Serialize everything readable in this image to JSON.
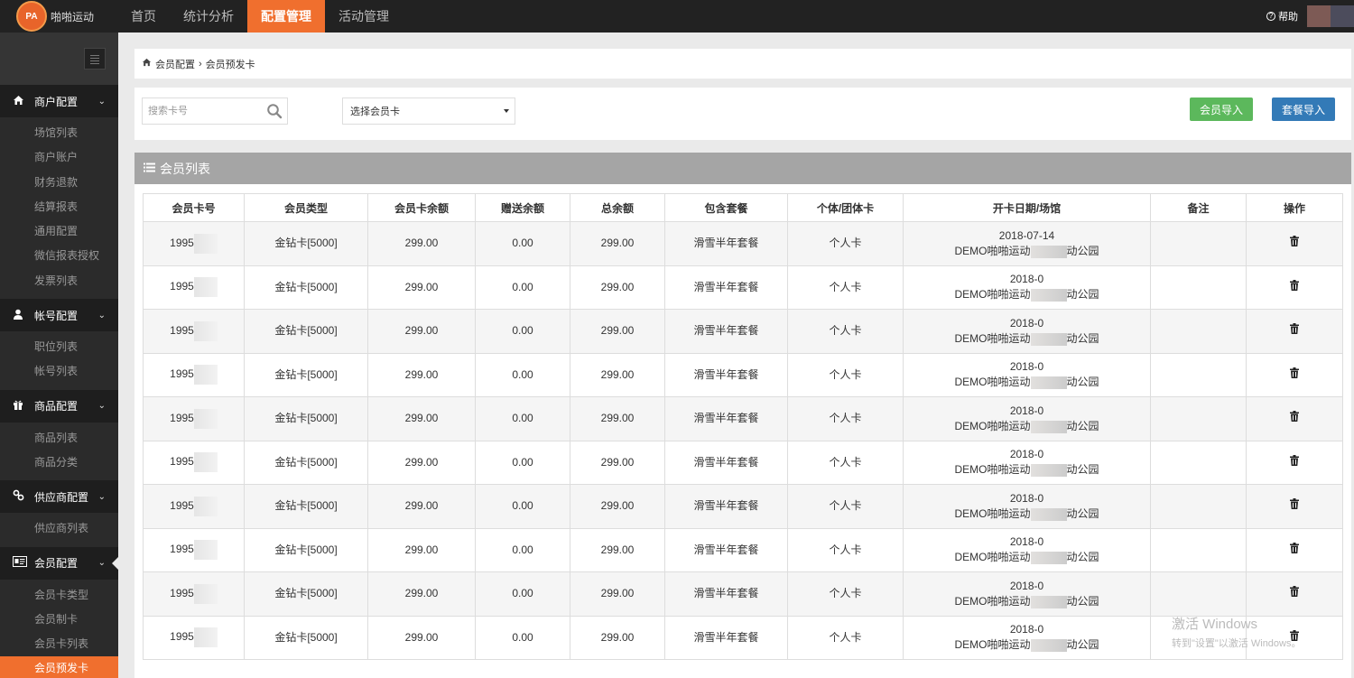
{
  "app": {
    "name": "啪啪运动",
    "logo_icon": "logo-badge",
    "accent_color": "#f06f2e"
  },
  "topnav": {
    "items": [
      {
        "label": "首页"
      },
      {
        "label": "统计分析"
      },
      {
        "label": "配置管理",
        "active": true
      },
      {
        "label": "活动管理"
      }
    ],
    "help_label": "帮助"
  },
  "sidebar": {
    "groups": [
      {
        "label": "商户配置",
        "icon": "home-icon",
        "items": [
          "场馆列表",
          "商户账户",
          "财务退款",
          "结算报表",
          "通用配置",
          "微信报表授权",
          "发票列表"
        ]
      },
      {
        "label": "帐号配置",
        "icon": "user-icon",
        "items": [
          "职位列表",
          "帐号列表"
        ]
      },
      {
        "label": "商品配置",
        "icon": "gift-icon",
        "items": [
          "商品列表",
          "商品分类"
        ]
      },
      {
        "label": "供应商配置",
        "icon": "link-icon",
        "items": [
          "供应商列表"
        ]
      },
      {
        "label": "会员配置",
        "icon": "id-card-icon",
        "items": [
          "会员卡类型",
          "会员制卡",
          "会员卡列表",
          "会员预发卡"
        ]
      }
    ],
    "active_item": "会员预发卡"
  },
  "breadcrumb": {
    "parent": "会员配置",
    "current": "会员预发卡"
  },
  "filter": {
    "search_placeholder": "搜索卡号",
    "select_value": "选择会员卡",
    "import_button": "会员导入",
    "package_button": "套餐导入"
  },
  "panel": {
    "title": "会员列表"
  },
  "table": {
    "headers": [
      "会员卡号",
      "会员类型",
      "会员卡余额",
      "赠送余额",
      "总余额",
      "包含套餐",
      "个体/团体卡",
      "开卡日期/场馆",
      "备注",
      "操作"
    ],
    "rows": [
      {
        "card": "1995",
        "type": "金钻卡[5000]",
        "balance": "299.00",
        "gift": "0.00",
        "total": "299.00",
        "package": "滑雪半年套餐",
        "kind": "个人卡",
        "date": "2018-07-14",
        "venue_a": "DEMO啪啪运动",
        "venue_b": "动公园",
        "note": ""
      },
      {
        "card": "1995",
        "type": "金钻卡[5000]",
        "balance": "299.00",
        "gift": "0.00",
        "total": "299.00",
        "package": "滑雪半年套餐",
        "kind": "个人卡",
        "date": "2018-0",
        "venue_a": "DEMO啪啪运动",
        "venue_b": "动公园",
        "note": ""
      },
      {
        "card": "1995",
        "type": "金钻卡[5000]",
        "balance": "299.00",
        "gift": "0.00",
        "total": "299.00",
        "package": "滑雪半年套餐",
        "kind": "个人卡",
        "date": "2018-0",
        "venue_a": "DEMO啪啪运动",
        "venue_b": "动公园",
        "note": ""
      },
      {
        "card": "1995",
        "type": "金钻卡[5000]",
        "balance": "299.00",
        "gift": "0.00",
        "total": "299.00",
        "package": "滑雪半年套餐",
        "kind": "个人卡",
        "date": "2018-0",
        "venue_a": "DEMO啪啪运动",
        "venue_b": "动公园",
        "note": ""
      },
      {
        "card": "1995",
        "type": "金钻卡[5000]",
        "balance": "299.00",
        "gift": "0.00",
        "total": "299.00",
        "package": "滑雪半年套餐",
        "kind": "个人卡",
        "date": "2018-0",
        "venue_a": "DEMO啪啪运动",
        "venue_b": "动公园",
        "note": ""
      },
      {
        "card": "1995",
        "type": "金钻卡[5000]",
        "balance": "299.00",
        "gift": "0.00",
        "total": "299.00",
        "package": "滑雪半年套餐",
        "kind": "个人卡",
        "date": "2018-0",
        "venue_a": "DEMO啪啪运动",
        "venue_b": "动公园",
        "note": ""
      },
      {
        "card": "1995",
        "type": "金钻卡[5000]",
        "balance": "299.00",
        "gift": "0.00",
        "total": "299.00",
        "package": "滑雪半年套餐",
        "kind": "个人卡",
        "date": "2018-0",
        "venue_a": "DEMO啪啪运动",
        "venue_b": "动公园",
        "note": ""
      },
      {
        "card": "1995",
        "type": "金钻卡[5000]",
        "balance": "299.00",
        "gift": "0.00",
        "total": "299.00",
        "package": "滑雪半年套餐",
        "kind": "个人卡",
        "date": "2018-0",
        "venue_a": "DEMO啪啪运动",
        "venue_b": "动公园",
        "note": ""
      },
      {
        "card": "1995",
        "type": "金钻卡[5000]",
        "balance": "299.00",
        "gift": "0.00",
        "total": "299.00",
        "package": "滑雪半年套餐",
        "kind": "个人卡",
        "date": "2018-0",
        "venue_a": "DEMO啪啪运动",
        "venue_b": "动公园",
        "note": ""
      },
      {
        "card": "1995",
        "type": "金钻卡[5000]",
        "balance": "299.00",
        "gift": "0.00",
        "total": "299.00",
        "package": "滑雪半年套餐",
        "kind": "个人卡",
        "date": "2018-0",
        "venue_a": "DEMO啪啪运动",
        "venue_b": "动公园",
        "note": ""
      }
    ],
    "action_icon": "trash-icon"
  },
  "watermark": {
    "line1": "激活 Windows",
    "line2": "转到\"设置\"以激活 Windows。"
  }
}
